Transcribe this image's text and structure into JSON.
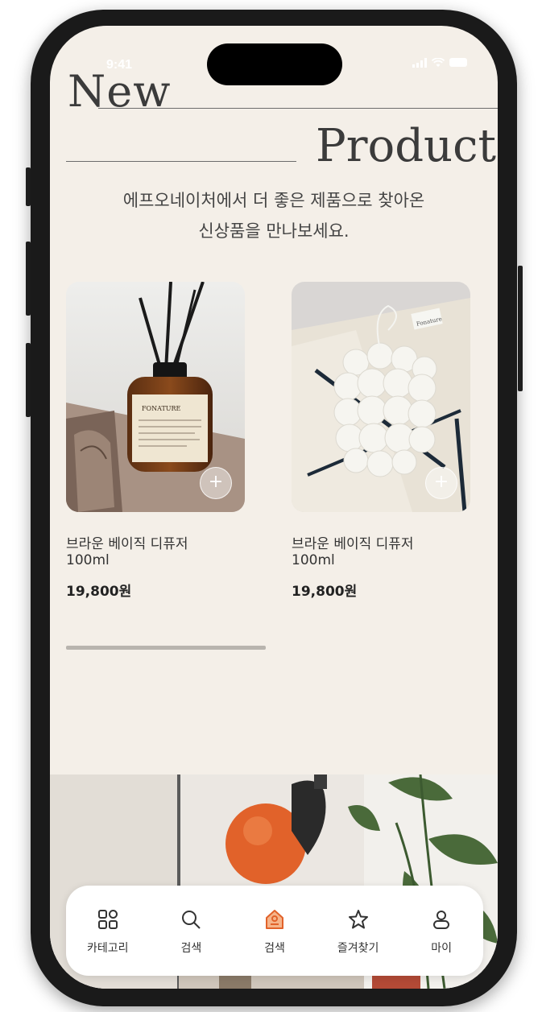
{
  "status": {
    "time": "9:41"
  },
  "header": {
    "title_line1": "New",
    "title_line2": "Product"
  },
  "subtitle": {
    "line1": "에프오네이처에서 더 좋은 제품으로 찾아온",
    "line2": "신상품을 만나보세요."
  },
  "products": [
    {
      "name_line1": "브라운 베이직 디퓨저",
      "name_line2": "100ml",
      "price": "19,800원",
      "add_symbol": "+"
    },
    {
      "name_line1": "브라운 베이직 디퓨저",
      "name_line2": "100ml",
      "price": "19,800원",
      "add_symbol": "+"
    }
  ],
  "product_images": {
    "diffuser_label": "FONATURE",
    "candle_tag": "Fonature"
  },
  "tabbar": {
    "items": [
      {
        "label": "카테고리",
        "icon": "category-icon"
      },
      {
        "label": "검색",
        "icon": "search-icon"
      },
      {
        "label": "검색",
        "icon": "home-icon",
        "active": true
      },
      {
        "label": "즐겨찾기",
        "icon": "star-icon"
      },
      {
        "label": "마이",
        "icon": "person-icon"
      }
    ]
  },
  "colors": {
    "background": "#f4efe8",
    "accent": "#e1622a",
    "text": "#3b3b3b"
  }
}
